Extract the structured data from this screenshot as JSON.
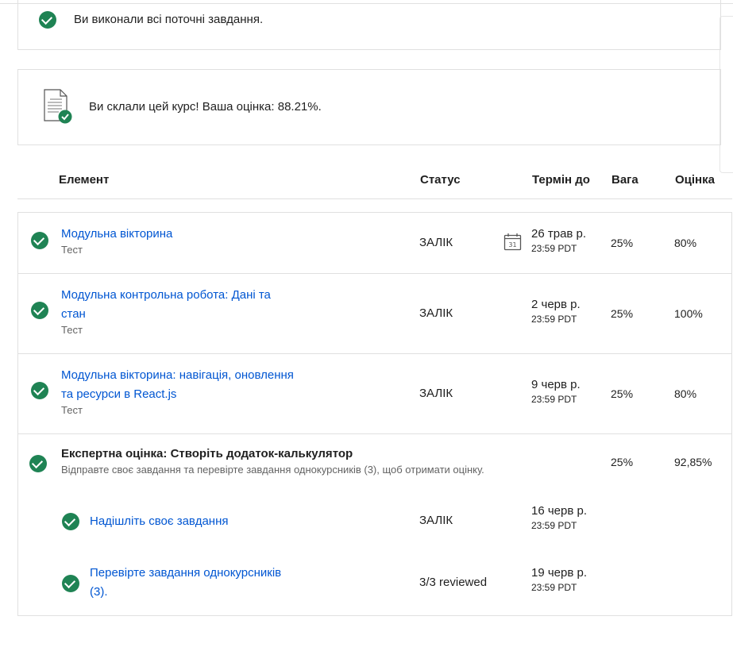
{
  "banner_done": {
    "text": "Ви виконали всі поточні завдання."
  },
  "banner_passed": {
    "text": "Ви склали цей курс! Ваша оцінка: 88.21%."
  },
  "table": {
    "headers": {
      "item": "Елемент",
      "status": "Статус",
      "due": "Термін до",
      "weight": "Вага",
      "grade": "Оцінка"
    },
    "rows": [
      {
        "title": "Модульна вікторина",
        "type": "Тест",
        "status": "ЗАЛІК",
        "due_date": "26 трав р.",
        "due_time": "23:59 PDT",
        "weight": "25%",
        "grade": "80%"
      },
      {
        "title_line1": "Модульна контрольна робота: Дані та",
        "title_line2": "стан",
        "type": "Тест",
        "status": "ЗАЛІК",
        "due_date": "2 черв р.",
        "due_time": "23:59 PDT",
        "weight": "25%",
        "grade": "100%"
      },
      {
        "title_line1": "Модульна вікторина: навігація, оновлення",
        "title_line2": "та ресурси в React.js",
        "type": "Тест",
        "status": "ЗАЛІК",
        "due_date": "9 черв р.",
        "due_time": "23:59 PDT",
        "weight": "25%",
        "grade": "80%"
      }
    ],
    "peer": {
      "title": "Експертна оцінка: Створіть додаток-калькулятор",
      "desc": "Відправте своє завдання та перевірте завдання однокурсників (3), щоб отримати оцінку.",
      "weight": "25%",
      "grade": "92,85%",
      "subitems": [
        {
          "title": "Надішліть своє завдання",
          "status": "ЗАЛІК",
          "due_date": "16 черв р.",
          "due_time": "23:59 PDT"
        },
        {
          "title_line1": "Перевірте завдання однокурсників",
          "title_line2": "(3).",
          "status": "3/3 reviewed",
          "due_date": "19 черв р.",
          "due_time": "23:59 PDT"
        }
      ]
    }
  },
  "icons": {
    "check": "check-circle-icon",
    "doc": "document-check-icon",
    "calendar": "calendar-icon"
  },
  "colors": {
    "success": "#1f8354",
    "link": "#0056d2"
  }
}
